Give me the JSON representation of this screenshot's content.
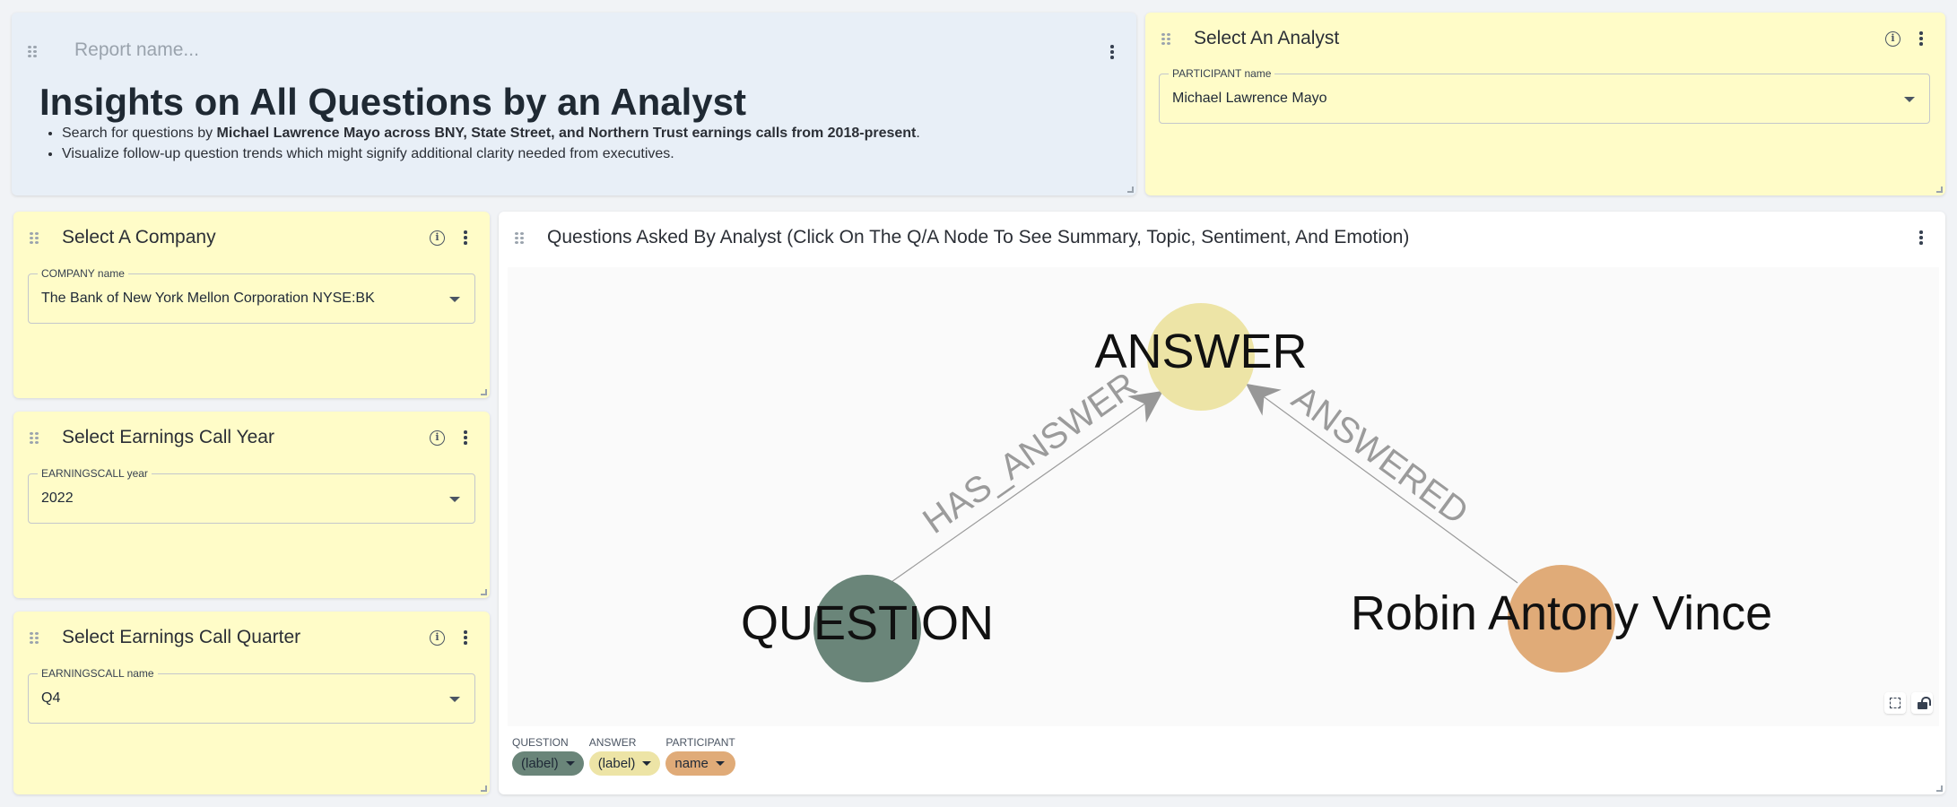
{
  "header": {
    "report_name_placeholder": "Report name...",
    "title": "Insights on All Questions by an Analyst",
    "bullet1": {
      "pre": "Search for questions by ",
      "bold": "Michael Lawrence Mayo across BNY, State Street, and Northern Trust earnings calls from 2018-present",
      "post": "."
    },
    "bullet2": "Visualize follow-up question trends which might signify additional clarity needed from executives."
  },
  "analyst_card": {
    "title": "Select An Analyst",
    "field_label": "PARTICIPANT name",
    "field_value": "Michael Lawrence Mayo"
  },
  "company_card": {
    "title": "Select A Company",
    "field_label": "COMPANY name",
    "field_value": "The Bank of New York Mellon Corporation NYSE:BK"
  },
  "year_card": {
    "title": "Select Earnings Call Year",
    "field_label": "EARNINGSCALL year",
    "field_value": "2022"
  },
  "quarter_card": {
    "title": "Select Earnings Call Quarter",
    "field_label": "EARNINGSCALL name",
    "field_value": "Q4"
  },
  "graph_card": {
    "title": "Questions Asked By Analyst (Click On The Q/A Node To See Summary, Topic, Sentiment, And Emotion)",
    "nodes": {
      "answer": {
        "label": "ANSWER",
        "color": "#ede4a6"
      },
      "question": {
        "label": "QUESTION",
        "color": "#6a8579"
      },
      "participant": {
        "label": "Robin Antony Vince",
        "color": "#e0ab78"
      }
    },
    "edges": {
      "has_answer": "HAS_ANSWER",
      "answered": "ANSWERED"
    },
    "legend": [
      {
        "category": "QUESTION",
        "value": "(label)",
        "color": "#6a8579"
      },
      {
        "category": "ANSWER",
        "value": "(label)",
        "color": "#ede4a6"
      },
      {
        "category": "PARTICIPANT",
        "value": "name",
        "color": "#e0ab78"
      }
    ]
  }
}
